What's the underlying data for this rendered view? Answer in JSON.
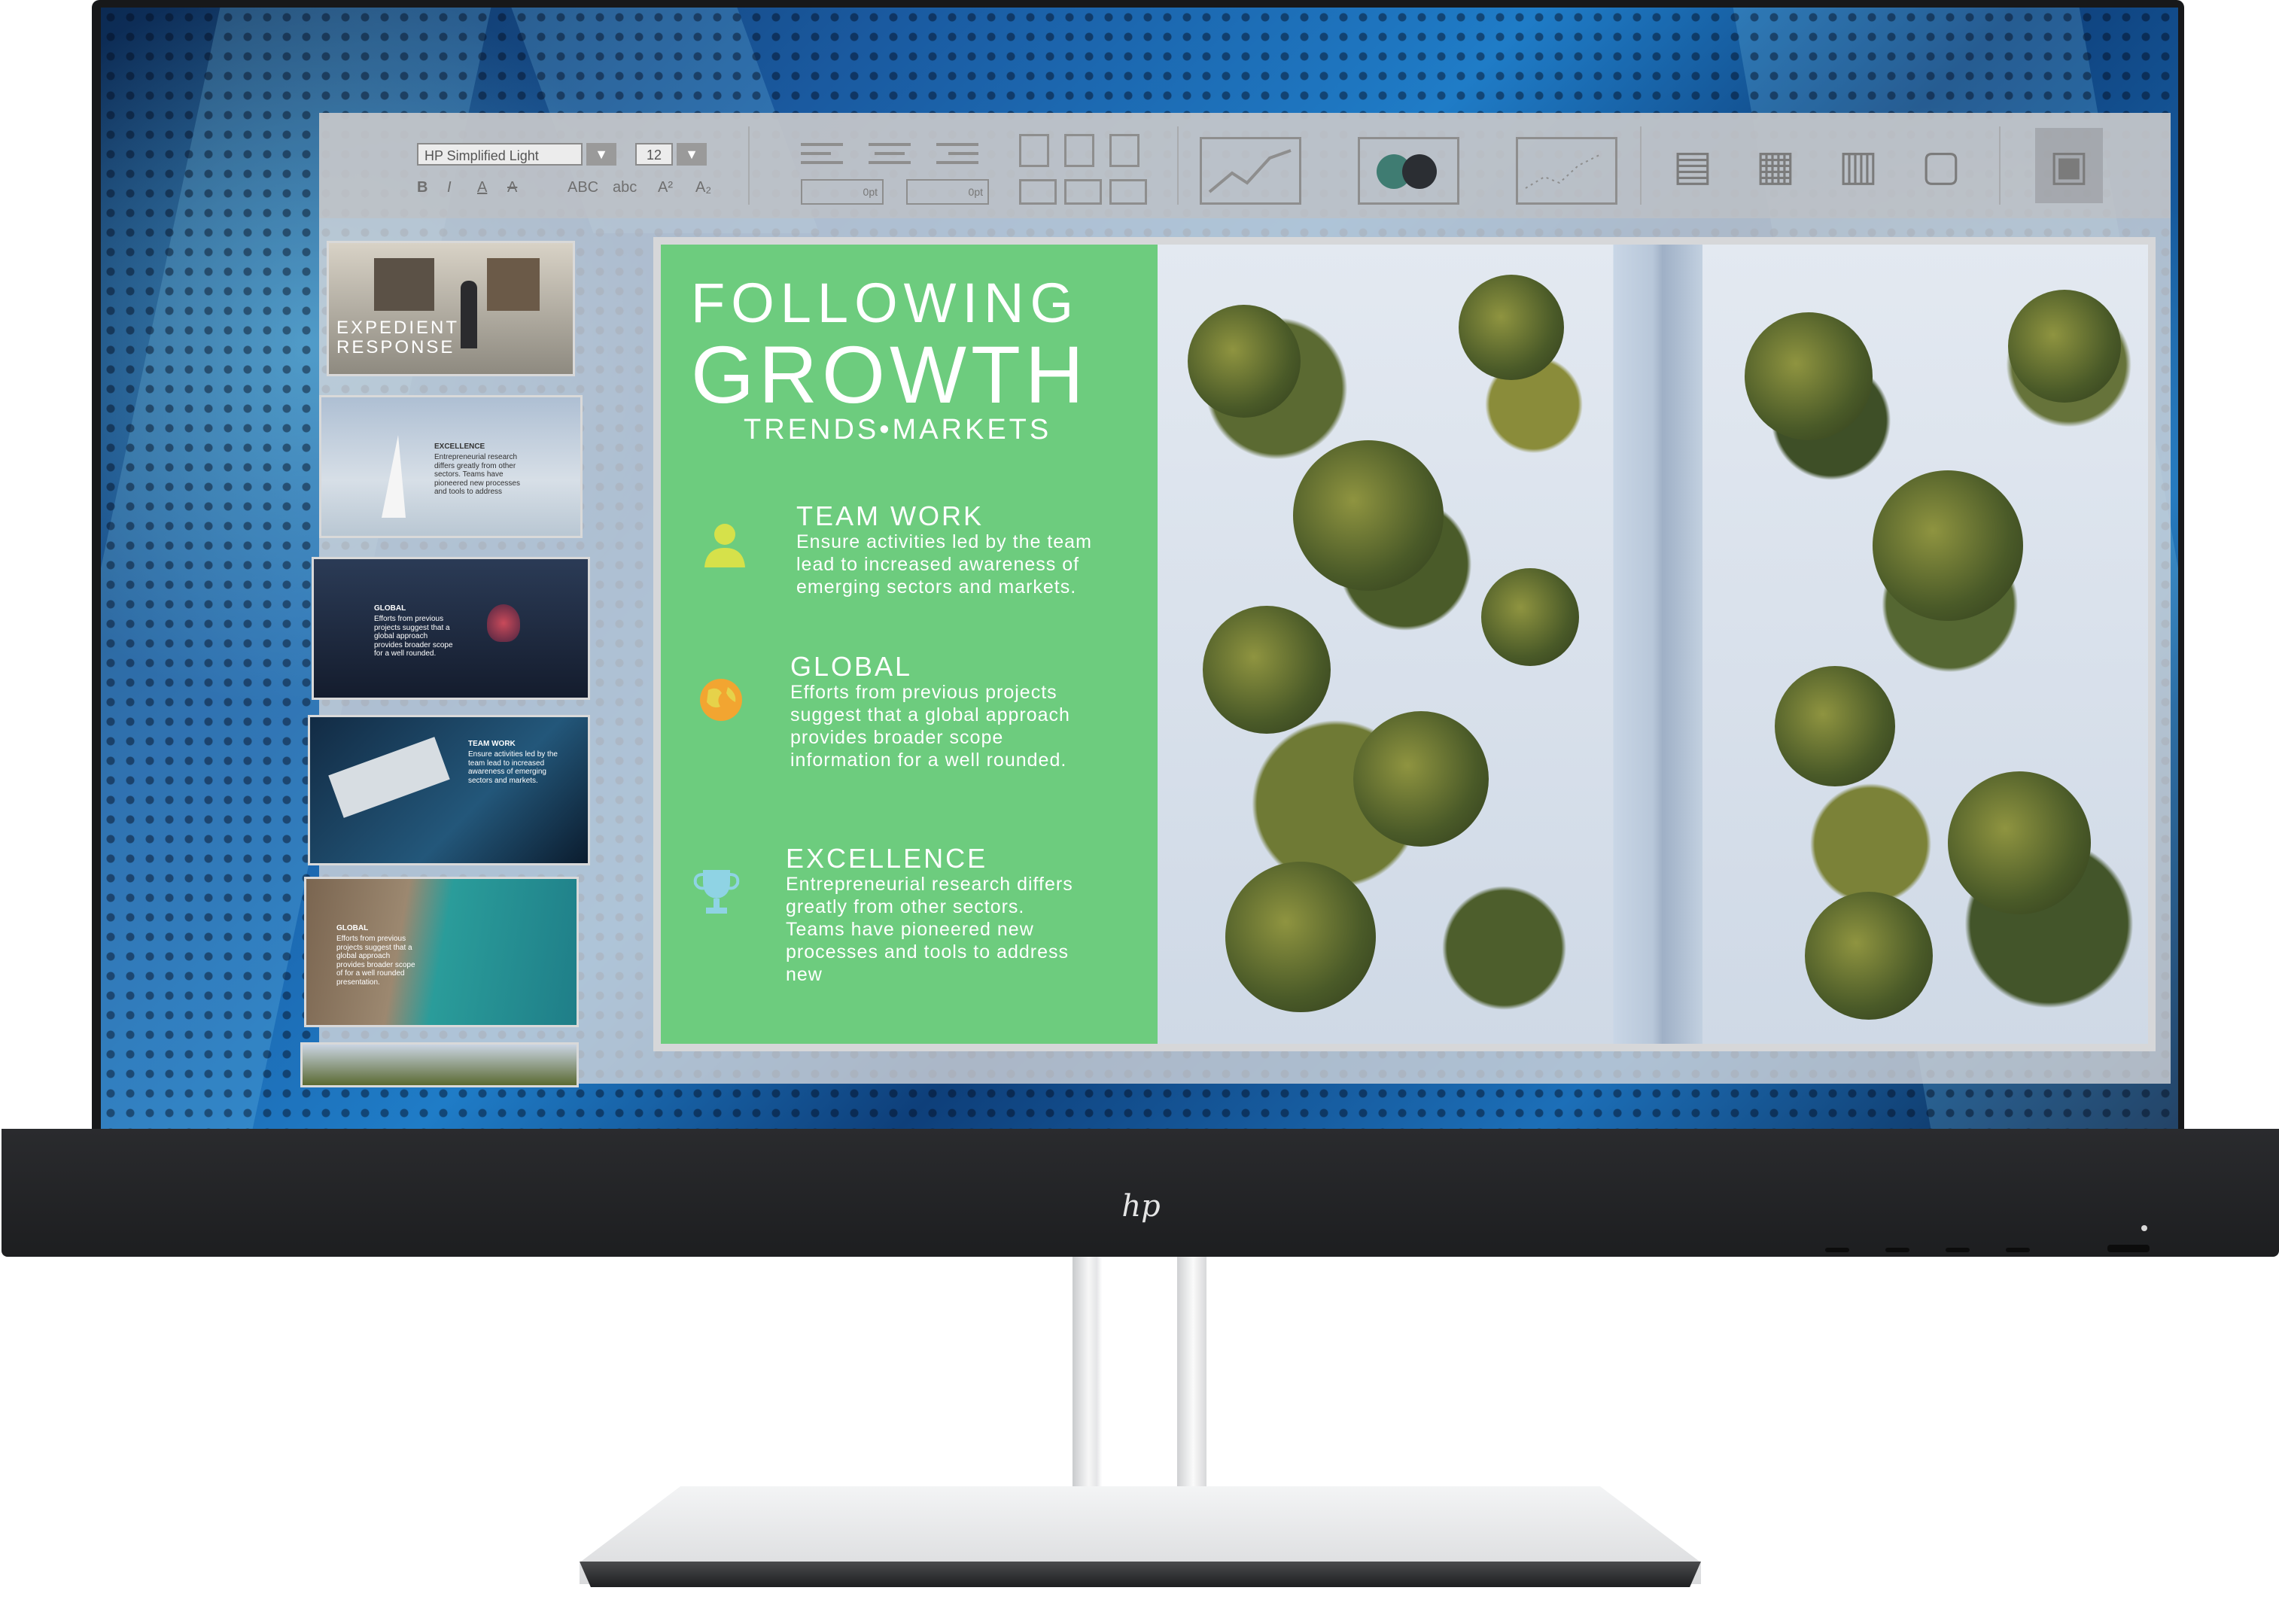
{
  "monitor": {
    "brand_logo": "hp"
  },
  "toolbar": {
    "font_name": "HP Simplified Light",
    "font_size": "12",
    "format_bold": "B",
    "format_italic": "I",
    "format_underline": "A",
    "format_clear": "A",
    "case_upper": "ABC",
    "case_lower": "abc",
    "superscript": "A²",
    "subscript": "A₂",
    "indent_opt_1": "0pt",
    "indent_opt_2": "0pt"
  },
  "thumbnails": [
    {
      "title": "EXPEDIENT\nRESPONSE"
    },
    {
      "title": "EXCELLENCE",
      "body": "Entrepreneurial research differs greatly from other sectors. Teams have pioneered new processes and tools to address"
    },
    {
      "title": "GLOBAL",
      "body": "Efforts from previous projects suggest that a global approach provides broader scope for a well rounded."
    },
    {
      "title": "TEAM WORK",
      "body": "Ensure activities led by the team lead to increased awareness of emerging sectors and markets."
    },
    {
      "title": "GLOBAL",
      "body": "Efforts from previous projects suggest that a global approach provides broader scope of for a well rounded presentation."
    }
  ],
  "slide": {
    "title_line_1": "FOLLOWING",
    "title_line_2": "GROWTH",
    "subtitle": "TRENDS•MARKETS",
    "sections": [
      {
        "heading": "TEAM WORK",
        "body": "Ensure activities led by the team lead to increased awareness of emerging sectors and markets.",
        "icon": "person-icon"
      },
      {
        "heading": "GLOBAL",
        "body": "Efforts from previous projects suggest that a global approach provides broader scope information for a well rounded.",
        "icon": "globe-icon"
      },
      {
        "heading": "EXCELLENCE",
        "body": "Entrepreneurial research differs greatly from other sectors. Teams have pioneered new processes and tools to address new",
        "icon": "trophy-icon"
      }
    ]
  },
  "colors": {
    "slide_green": "#6dcc7e",
    "wallpaper_blue": "#1f7cc7",
    "bezel": "#17181a"
  }
}
